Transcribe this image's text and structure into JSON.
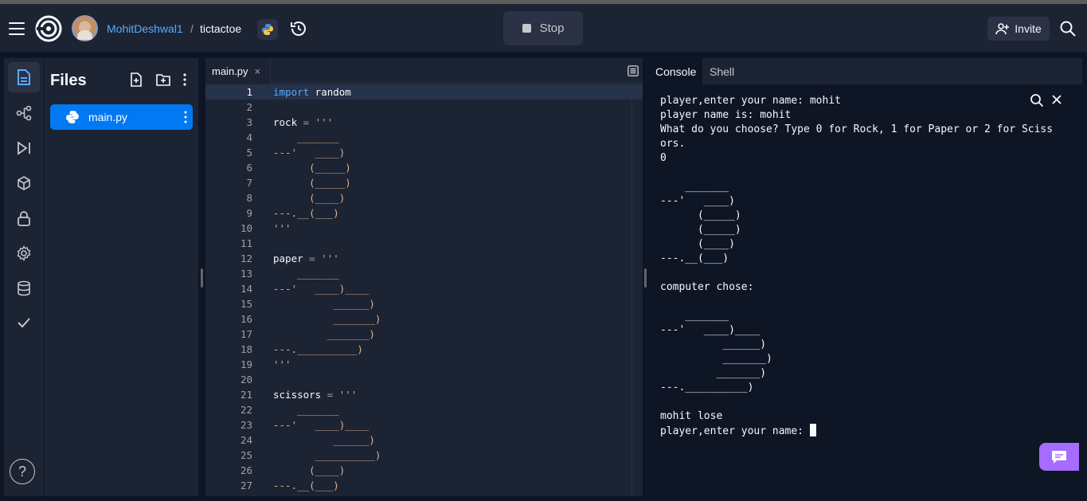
{
  "header": {
    "username": "MohitDeshwal1",
    "separator": "/",
    "repl_name": "tictactoe",
    "stop_label": "Stop",
    "invite_label": "Invite"
  },
  "sidebar": {
    "help_label": "?"
  },
  "files": {
    "title": "Files",
    "items": [
      {
        "name": "main.py"
      }
    ]
  },
  "editor": {
    "tab_label": "main.py",
    "tab_close": "×",
    "current_line": 1
  },
  "code_lines": [
    {
      "n": "1",
      "t": "import random"
    },
    {
      "n": "2",
      "t": ""
    },
    {
      "n": "3",
      "t": "rock = '''"
    },
    {
      "n": "4",
      "t": "    _______"
    },
    {
      "n": "5",
      "t": "---'   ____)"
    },
    {
      "n": "6",
      "t": "      (_____)"
    },
    {
      "n": "7",
      "t": "      (_____)"
    },
    {
      "n": "8",
      "t": "      (____)"
    },
    {
      "n": "9",
      "t": "---.__(___)"
    },
    {
      "n": "10",
      "t": "'''"
    },
    {
      "n": "11",
      "t": ""
    },
    {
      "n": "12",
      "t": "paper = '''"
    },
    {
      "n": "13",
      "t": "    _______"
    },
    {
      "n": "14",
      "t": "---'   ____)____"
    },
    {
      "n": "15",
      "t": "          ______)"
    },
    {
      "n": "16",
      "t": "          _______)"
    },
    {
      "n": "17",
      "t": "         _______)"
    },
    {
      "n": "18",
      "t": "---.__________)"
    },
    {
      "n": "19",
      "t": "'''"
    },
    {
      "n": "20",
      "t": ""
    },
    {
      "n": "21",
      "t": "scissors = '''"
    },
    {
      "n": "22",
      "t": "    _______"
    },
    {
      "n": "23",
      "t": "---'   ____)____"
    },
    {
      "n": "24",
      "t": "          ______)"
    },
    {
      "n": "25",
      "t": "       __________)"
    },
    {
      "n": "26",
      "t": "      (____)"
    },
    {
      "n": "27",
      "t": "---.__(___)"
    }
  ],
  "console": {
    "tabs": [
      "Console",
      "Shell"
    ],
    "output": "player,enter your name: mohit\nplayer name is: mohit\nWhat do you choose? Type 0 for Rock, 1 for Paper or 2 for Sciss\nors.\n0\n\n    _______\n---'   ____)\n      (_____)\n      (_____)\n      (____)\n---.__(___)\n\ncomputer chose:\n\n    _______\n---'   ____)____\n          ______)\n          _______)\n         _______)\n---.__________)\n\nmohit lose\nplayer,enter your name: "
  },
  "colors": {
    "bg": "#0e1525",
    "surface": "#1c2333",
    "accent": "#0079f2",
    "username": "#57abff",
    "string": "#e3b089",
    "chat": "#a66bff"
  }
}
